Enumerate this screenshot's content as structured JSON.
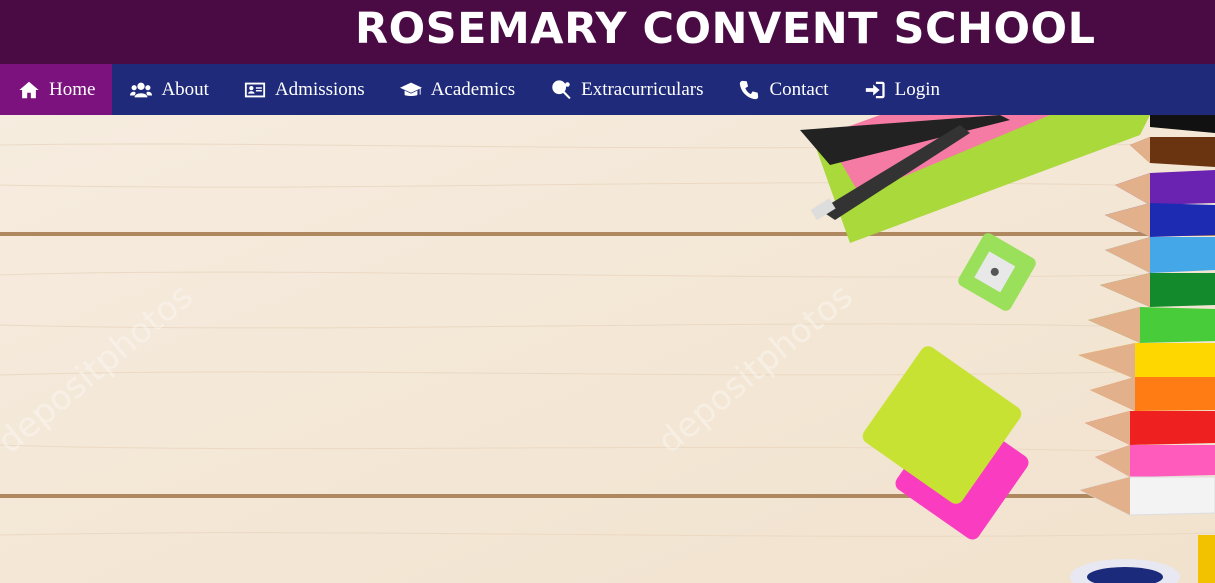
{
  "header": {
    "title": "ROSEMARY CONVENT SCHOOL"
  },
  "nav": {
    "items": [
      {
        "label": "Home",
        "icon": "home-icon"
      },
      {
        "label": "About",
        "icon": "users-icon"
      },
      {
        "label": "Admissions",
        "icon": "id-card-icon"
      },
      {
        "label": "Academics",
        "icon": "graduation-cap-icon"
      },
      {
        "label": "Extracurriculars",
        "icon": "table-tennis-icon"
      },
      {
        "label": "Contact",
        "icon": "phone-icon"
      },
      {
        "label": "Login",
        "icon": "sign-in-icon"
      }
    ],
    "active": "Home"
  },
  "hero": {
    "image": "wooden-desk-with-colored-pencils",
    "watermark": "depositphotos"
  },
  "colors": {
    "header_bg": "#4a0b45",
    "nav_bg": "#1f2b7a",
    "nav_active": "#7b127e"
  }
}
